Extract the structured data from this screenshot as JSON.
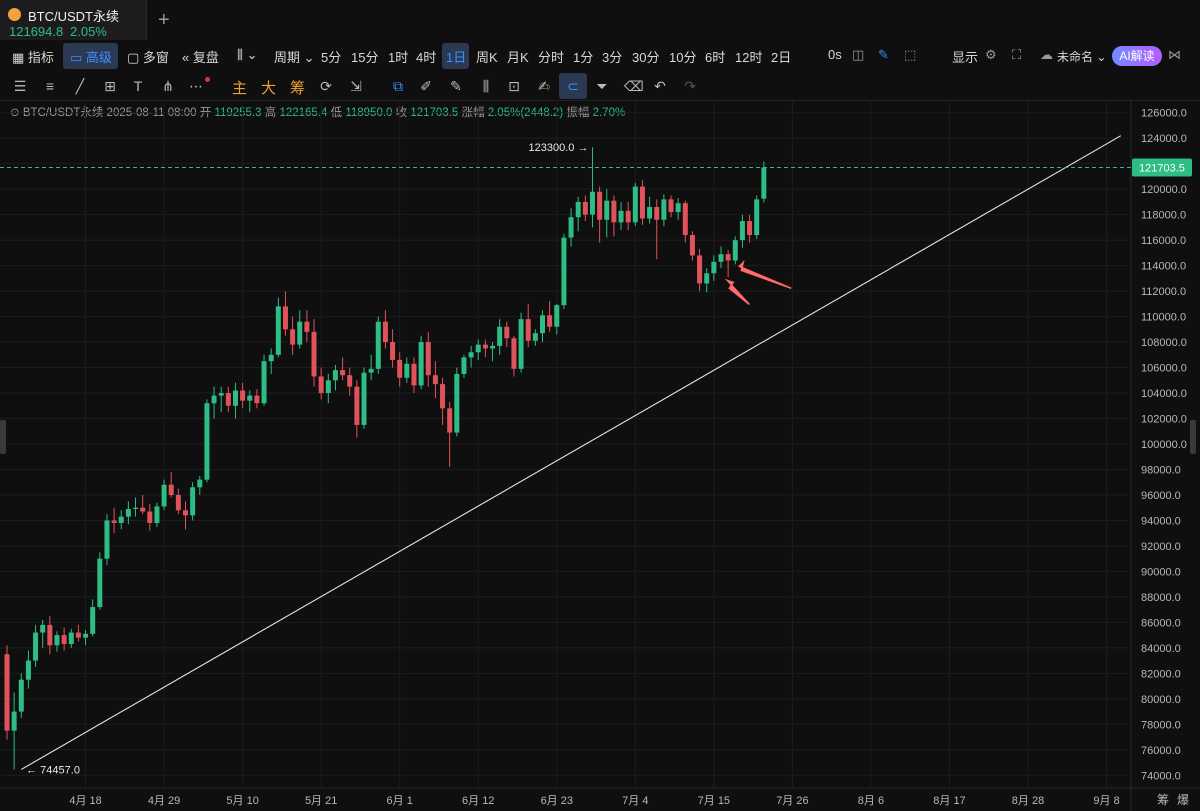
{
  "tab": {
    "symbol": "BTC/USDT永续",
    "price": "121694.8",
    "change": "2.05%",
    "add": "+"
  },
  "toolbar": {
    "items": [
      "指标",
      "高级",
      "多窗",
      "复盘",
      "周期",
      "5分",
      "15分",
      "1时",
      "4时",
      "1日",
      "周K",
      "月K",
      "分时",
      "1分",
      "3分",
      "30分",
      "10分",
      "6时",
      "12时",
      "2日",
      "0s",
      "显示",
      "未命名",
      "AI解读"
    ],
    "selected": [
      "高级",
      "1日"
    ]
  },
  "drawing_tools": {
    "labels": [
      "主",
      "大",
      "筹"
    ]
  },
  "info_bar": {
    "symbol": "BTC/USDT永续",
    "date": "2025-08-11 08:00",
    "open_label": "开",
    "open": "119255.3",
    "high_label": "高",
    "high": "122165.4",
    "low_label": "低",
    "low": "118950.0",
    "close_label": "收",
    "close": "121703.5",
    "change_label": "涨幅",
    "change": "2.05%(2448.2)",
    "amp_label": "振幅",
    "amp": "2.70%"
  },
  "chart_data": {
    "type": "candlestick",
    "ylim": [
      73000,
      127000
    ],
    "yticks": [
      74000,
      76000,
      78000,
      80000,
      82000,
      84000,
      86000,
      88000,
      90000,
      92000,
      94000,
      96000,
      98000,
      100000,
      102000,
      104000,
      106000,
      108000,
      110000,
      112000,
      114000,
      116000,
      118000,
      120000,
      122000,
      124000,
      126000
    ],
    "ytick_labels": [
      "74000.0",
      "76000.0",
      "78000.0",
      "80000.0",
      "82000.0",
      "84000.0",
      "86000.0",
      "88000.0",
      "90000.0",
      "92000.0",
      "94000.0",
      "96000.0",
      "98000.0",
      "100000.0",
      "102000.0",
      "104000.0",
      "106000.0",
      "108000.0",
      "110000.0",
      "112000.0",
      "114000.0",
      "116000.0",
      "118000.0",
      "120000.0",
      "122000.0",
      "124000.0",
      "126000.0"
    ],
    "x_start": "2025-04-07",
    "xtick_labels": [
      {
        "label": "4月 18",
        "date": "2025-04-18"
      },
      {
        "label": "4月 29",
        "date": "2025-04-29"
      },
      {
        "label": "5月 10",
        "date": "2025-05-10"
      },
      {
        "label": "5月 21",
        "date": "2025-05-21"
      },
      {
        "label": "6月 1",
        "date": "2025-06-01"
      },
      {
        "label": "6月 12",
        "date": "2025-06-12"
      },
      {
        "label": "6月 23",
        "date": "2025-06-23"
      },
      {
        "label": "7月 4",
        "date": "2025-07-04"
      },
      {
        "label": "7月 15",
        "date": "2025-07-15"
      },
      {
        "label": "7月 26",
        "date": "2025-07-26"
      },
      {
        "label": "8月 6",
        "date": "2025-08-06"
      },
      {
        "label": "8月 17",
        "date": "2025-08-17"
      },
      {
        "label": "8月 28",
        "date": "2025-08-28"
      },
      {
        "label": "9月 8",
        "date": "2025-09-08"
      }
    ],
    "candles": [
      [
        83500,
        84200,
        76800,
        77500
      ],
      [
        77500,
        80500,
        74457,
        79000
      ],
      [
        79000,
        82000,
        78500,
        81500
      ],
      [
        81500,
        83800,
        80800,
        83000
      ],
      [
        83000,
        85800,
        82500,
        85200
      ],
      [
        85200,
        86200,
        84000,
        85800
      ],
      [
        85800,
        86500,
        83500,
        84200
      ],
      [
        84200,
        85300,
        83700,
        85000
      ],
      [
        85000,
        85600,
        83800,
        84300
      ],
      [
        84300,
        85500,
        84000,
        85200
      ],
      [
        85200,
        85800,
        84500,
        84800
      ],
      [
        84800,
        85400,
        84200,
        85100
      ],
      [
        85100,
        87800,
        84900,
        87200
      ],
      [
        87200,
        91500,
        87000,
        91000
      ],
      [
        91000,
        94500,
        90500,
        94000
      ],
      [
        94000,
        95000,
        93000,
        93800
      ],
      [
        93800,
        94800,
        93300,
        94300
      ],
      [
        94300,
        95500,
        93700,
        94900
      ],
      [
        94900,
        95800,
        94300,
        95000
      ],
      [
        95000,
        96000,
        94500,
        94700
      ],
      [
        94700,
        95300,
        93200,
        93800
      ],
      [
        93800,
        95400,
        93500,
        95100
      ],
      [
        95100,
        97200,
        94800,
        96800
      ],
      [
        96800,
        97800,
        95800,
        96000
      ],
      [
        96000,
        96500,
        94500,
        94800
      ],
      [
        94800,
        95500,
        93300,
        94400
      ],
      [
        94400,
        97000,
        94000,
        96600
      ],
      [
        96600,
        97500,
        96000,
        97200
      ],
      [
        97200,
        103500,
        97000,
        103200
      ],
      [
        103200,
        104500,
        102000,
        103800
      ],
      [
        103800,
        104500,
        102500,
        104000
      ],
      [
        104000,
        104500,
        102500,
        103000
      ],
      [
        103000,
        104800,
        102000,
        104200
      ],
      [
        104200,
        104800,
        102800,
        103400
      ],
      [
        103400,
        104200,
        102500,
        103800
      ],
      [
        103800,
        104300,
        102800,
        103200
      ],
      [
        103200,
        107000,
        103000,
        106500
      ],
      [
        106500,
        107500,
        105500,
        107000
      ],
      [
        107000,
        111500,
        106800,
        110800
      ],
      [
        110800,
        111980,
        108500,
        109000
      ],
      [
        109000,
        110000,
        107000,
        107800
      ],
      [
        107800,
        110500,
        107500,
        109600
      ],
      [
        109600,
        110500,
        108000,
        108800
      ],
      [
        108800,
        109800,
        104500,
        105300
      ],
      [
        105300,
        106000,
        103500,
        104000
      ],
      [
        104000,
        105500,
        103200,
        105000
      ],
      [
        105000,
        106200,
        104200,
        105800
      ],
      [
        105800,
        106800,
        105000,
        105400
      ],
      [
        105400,
        106000,
        103800,
        104500
      ],
      [
        104500,
        105000,
        100500,
        101500
      ],
      [
        101500,
        106000,
        101200,
        105600
      ],
      [
        105600,
        107000,
        105000,
        105900
      ],
      [
        105900,
        110000,
        105500,
        109600
      ],
      [
        109600,
        110500,
        107500,
        108000
      ],
      [
        108000,
        109000,
        106000,
        106600
      ],
      [
        106600,
        107200,
        104500,
        105200
      ],
      [
        105200,
        106800,
        104800,
        106300
      ],
      [
        106300,
        106800,
        104000,
        104600
      ],
      [
        104600,
        108500,
        104300,
        108000
      ],
      [
        108000,
        108800,
        104500,
        105400
      ],
      [
        105400,
        106500,
        103600,
        104700
      ],
      [
        104700,
        105200,
        101500,
        102800
      ],
      [
        102800,
        103300,
        98200,
        100900
      ],
      [
        100900,
        106000,
        100600,
        105500
      ],
      [
        105500,
        107000,
        105200,
        106800
      ],
      [
        106800,
        107700,
        106000,
        107200
      ],
      [
        107200,
        108200,
        106600,
        107800
      ],
      [
        107800,
        108200,
        106800,
        107500
      ],
      [
        107500,
        108000,
        106500,
        107700
      ],
      [
        107700,
        109800,
        107000,
        109200
      ],
      [
        109200,
        109600,
        107600,
        108300
      ],
      [
        108300,
        108500,
        105300,
        105900
      ],
      [
        105900,
        110300,
        105600,
        109800
      ],
      [
        109800,
        111000,
        107600,
        108100
      ],
      [
        108100,
        109000,
        107700,
        108700
      ],
      [
        108700,
        110500,
        108000,
        110100
      ],
      [
        110100,
        111200,
        108800,
        109200
      ],
      [
        109200,
        111000,
        108600,
        110900
      ],
      [
        110900,
        116500,
        110600,
        116200
      ],
      [
        116200,
        118500,
        115500,
        117800
      ],
      [
        117800,
        119400,
        116700,
        119000
      ],
      [
        119000,
        119500,
        117500,
        118000
      ],
      [
        118000,
        123300,
        117000,
        119800
      ],
      [
        119800,
        120200,
        115800,
        117600
      ],
      [
        117600,
        120000,
        116200,
        119100
      ],
      [
        119100,
        119500,
        116300,
        117400
      ],
      [
        117400,
        119000,
        116800,
        118300
      ],
      [
        118300,
        119000,
        116800,
        117400
      ],
      [
        117400,
        120500,
        117100,
        120200
      ],
      [
        120200,
        120700,
        117200,
        117700
      ],
      [
        117700,
        119400,
        117300,
        118600
      ],
      [
        118600,
        119200,
        114500,
        117600
      ],
      [
        117600,
        119600,
        117100,
        119200
      ],
      [
        119200,
        119500,
        117800,
        118200
      ],
      [
        118200,
        119300,
        117600,
        118900
      ],
      [
        118900,
        119100,
        115800,
        116400
      ],
      [
        116400,
        116700,
        114400,
        114800
      ],
      [
        114800,
        115300,
        112000,
        112600
      ],
      [
        112600,
        113800,
        111900,
        113400
      ],
      [
        113400,
        114800,
        112800,
        114300
      ],
      [
        114300,
        115500,
        113800,
        114900
      ],
      [
        114900,
        115200,
        113100,
        114400
      ],
      [
        114400,
        116300,
        114100,
        116000
      ],
      [
        116000,
        118000,
        115400,
        117500
      ],
      [
        117500,
        118000,
        115800,
        116400
      ],
      [
        116400,
        119500,
        116100,
        119200
      ],
      [
        119255.3,
        122165.4,
        118950,
        121703.5
      ]
    ],
    "annotations": {
      "high_label": "123300.0",
      "low_label": "74457.0",
      "last_price_label": "121703.5"
    },
    "trendline": {
      "from": {
        "date": "2025-04-09",
        "price": 74457
      },
      "to": {
        "date": "2025-09-10",
        "price": 124200
      }
    }
  },
  "colors": {
    "up": "#2ebd85",
    "down": "#e0535a",
    "bg": "#0f0f10",
    "grid": "#1c1d20",
    "accent": "#3d8eff"
  },
  "footer": {
    "labels": [
      "筹",
      "爆"
    ]
  }
}
